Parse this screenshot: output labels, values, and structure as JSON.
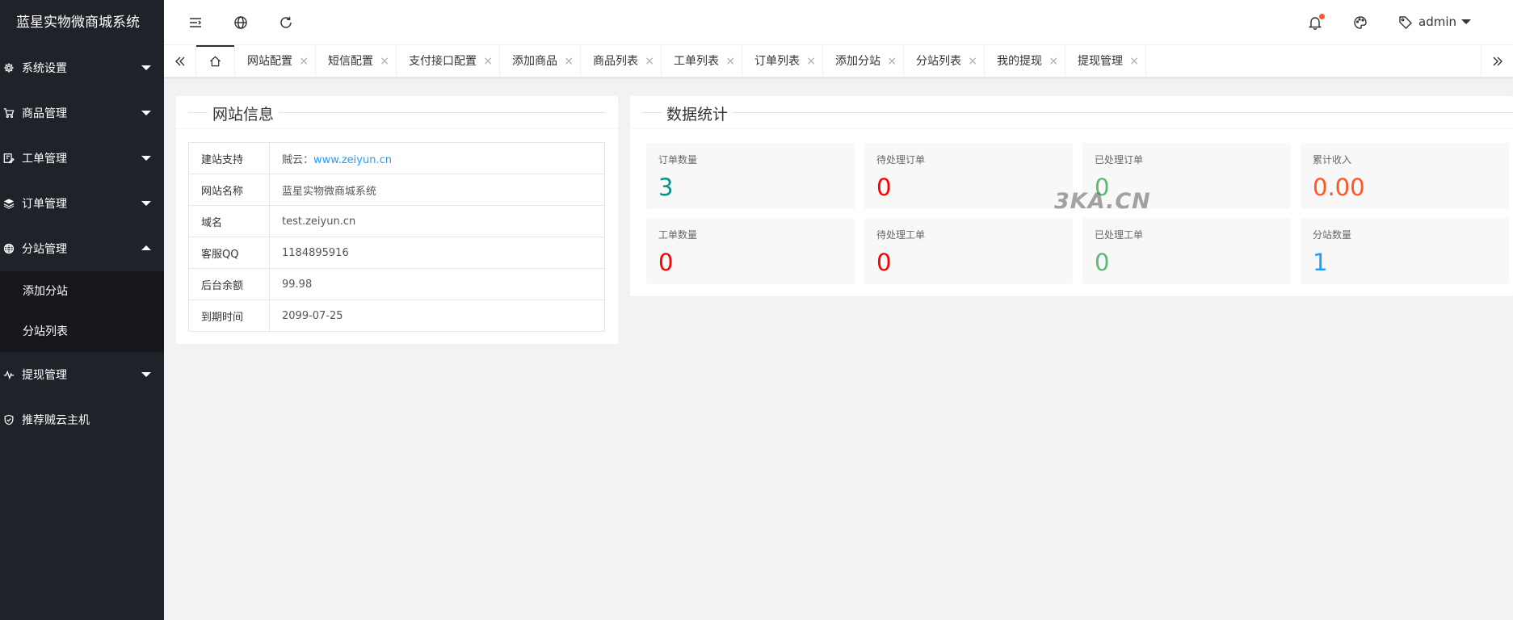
{
  "app": {
    "title": "蓝星实物微商城系统"
  },
  "sidebar": {
    "items": [
      {
        "label": "系统设置",
        "icon": "gear-icon",
        "expanded": false
      },
      {
        "label": "商品管理",
        "icon": "cart-icon",
        "expanded": false
      },
      {
        "label": "工单管理",
        "icon": "ticket-icon",
        "expanded": false
      },
      {
        "label": "订单管理",
        "icon": "layers-icon",
        "expanded": false
      },
      {
        "label": "分站管理",
        "icon": "globe-icon",
        "expanded": true,
        "children": [
          {
            "label": "添加分站"
          },
          {
            "label": "分站列表"
          }
        ]
      },
      {
        "label": "提现管理",
        "icon": "pulse-icon",
        "expanded": false
      },
      {
        "label": "推荐贼云主机",
        "icon": "shield-icon"
      }
    ]
  },
  "header": {
    "user": "admin",
    "has_notification": true
  },
  "tabs": [
    {
      "label": "网站配置"
    },
    {
      "label": "短信配置"
    },
    {
      "label": "支付接口配置"
    },
    {
      "label": "添加商品"
    },
    {
      "label": "商品列表"
    },
    {
      "label": "工单列表"
    },
    {
      "label": "订单列表"
    },
    {
      "label": "添加分站"
    },
    {
      "label": "分站列表"
    },
    {
      "label": "我的提现"
    },
    {
      "label": "提现管理"
    }
  ],
  "tab_close_glyph": "×",
  "site_info": {
    "title": "网站信息",
    "rows": [
      {
        "key": "建站支持",
        "prefix": "贼云：",
        "link": "www.zeiyun.cn"
      },
      {
        "key": "网站名称",
        "value": "蓝星实物微商城系统"
      },
      {
        "key": "域名",
        "value": "test.zeiyun.cn"
      },
      {
        "key": "客服QQ",
        "value": "1184895916"
      },
      {
        "key": "后台余额",
        "value": "99.98"
      },
      {
        "key": "到期时间",
        "value": "2099-07-25"
      }
    ]
  },
  "stats": {
    "title": "数据统计",
    "items": [
      {
        "label": "订单数量",
        "value": "3",
        "color": "#009688"
      },
      {
        "label": "待处理订单",
        "value": "0",
        "color": "#ff0000"
      },
      {
        "label": "已处理订单",
        "value": "0",
        "color": "#5fb878"
      },
      {
        "label": "累计收入",
        "value": "0.00",
        "color": "#ff5722"
      },
      {
        "label": "工单数量",
        "value": "0",
        "color": "#ff0000"
      },
      {
        "label": "待处理工单",
        "value": "0",
        "color": "#ff0000"
      },
      {
        "label": "已处理工单",
        "value": "0",
        "color": "#5fb878"
      },
      {
        "label": "分站数量",
        "value": "1",
        "color": "#1e9fff"
      }
    ]
  },
  "watermark": "3KA.CN"
}
